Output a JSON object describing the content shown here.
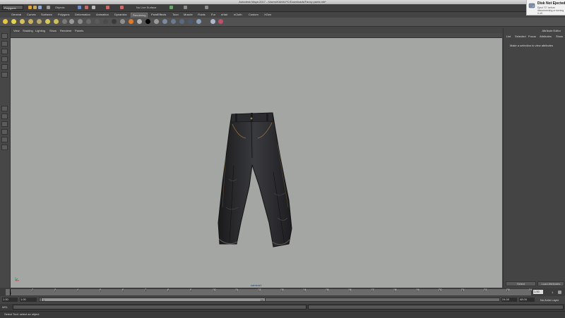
{
  "window": {
    "title": "Autodesk Maya 2017 - /Users/KAMILPC/Downloads/Fancy pants.mb*"
  },
  "statusline": {
    "mode": "Polygons",
    "objects_label": "Objects",
    "live_surface": "No Live Surface"
  },
  "shelf_tabs": [
    "General",
    "Curves",
    "Surfaces",
    "Polygons",
    "Deformation",
    "Animation",
    "Dynamics",
    "Rendering",
    "PaintEffects",
    "Toon",
    "Muscle",
    "Fluids",
    "Fur",
    "nHair",
    "nCloth",
    "Custom",
    "XGen"
  ],
  "shelf_active_tab": "Rendering",
  "panel_menus": [
    "View",
    "Shading",
    "Lighting",
    "Show",
    "Renderer",
    "Panels"
  ],
  "viewport": {
    "camera": "camera1",
    "background": "#a4a6a3"
  },
  "attribute_editor": {
    "title": "Attribute Editor",
    "tabs": [
      "List",
      "Selected",
      "Focus",
      "Attributes",
      "Show"
    ],
    "message": "Make a selection to view attributes",
    "select_button": "Select",
    "load_attributes_button": "Load Attributes"
  },
  "time_slider": {
    "ticks": [
      "1",
      "2",
      "3",
      "4",
      "5",
      "6",
      "7",
      "8",
      "9",
      "10",
      "11",
      "12",
      "13",
      "14",
      "15",
      "16",
      "17",
      "18",
      "19",
      "20",
      "21",
      "22",
      "23",
      "24"
    ],
    "current_frame_marker": "1",
    "current_time": "1.00",
    "fps": "1"
  },
  "range_slider": {
    "start": "1.00",
    "inner_start": "1.00",
    "handle_start": "1",
    "handle_end": "24",
    "inner_end": "24.00",
    "end": "48.00",
    "anim_layer": "No Anim Layer"
  },
  "command_line": {
    "language": "MEL"
  },
  "help_line": {
    "text": "Select Tool: select an object"
  },
  "notification": {
    "title": "Disk Not Ejected Properly",
    "body": "Eject \"G\" before disconnecting or turning it off."
  }
}
